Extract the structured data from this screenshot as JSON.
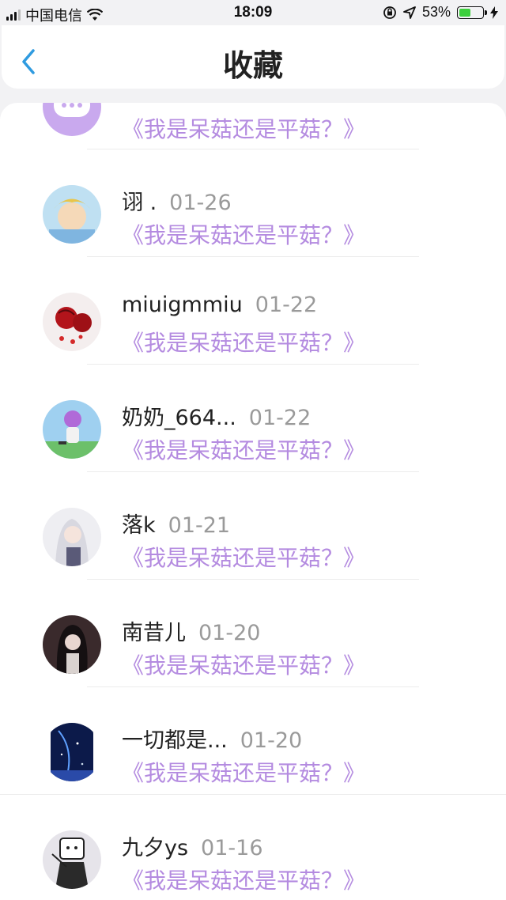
{
  "status_bar": {
    "carrier": "中国电信",
    "time": "18:09",
    "battery_percent": "53%",
    "battery_level": 0.53
  },
  "header": {
    "title": "收藏"
  },
  "favorites": [
    {
      "name": "",
      "date": "",
      "title": "《我是呆菇还是平菇？》"
    },
    {
      "name": "诩 .",
      "date": "01-26",
      "title": "《我是呆菇还是平菇？》"
    },
    {
      "name": "miuigmmiu",
      "date": "01-22",
      "title": "《我是呆菇还是平菇？》"
    },
    {
      "name": "奶奶_664...",
      "date": "01-22",
      "title": "《我是呆菇还是平菇？》"
    },
    {
      "name": "落k",
      "date": "01-21",
      "title": "《我是呆菇还是平菇？》"
    },
    {
      "name": "南昔儿",
      "date": "01-20",
      "title": "《我是呆菇还是平菇？》"
    },
    {
      "name": "一切都是...",
      "date": "01-20",
      "title": "《我是呆菇还是平菇？》"
    },
    {
      "name": "九夕ys",
      "date": "01-16",
      "title": "《我是呆菇还是平菇？》"
    }
  ],
  "colors": {
    "accent": "#2f9be0",
    "title_purple": "#b48be0",
    "date_gray": "#9a9a9a"
  }
}
